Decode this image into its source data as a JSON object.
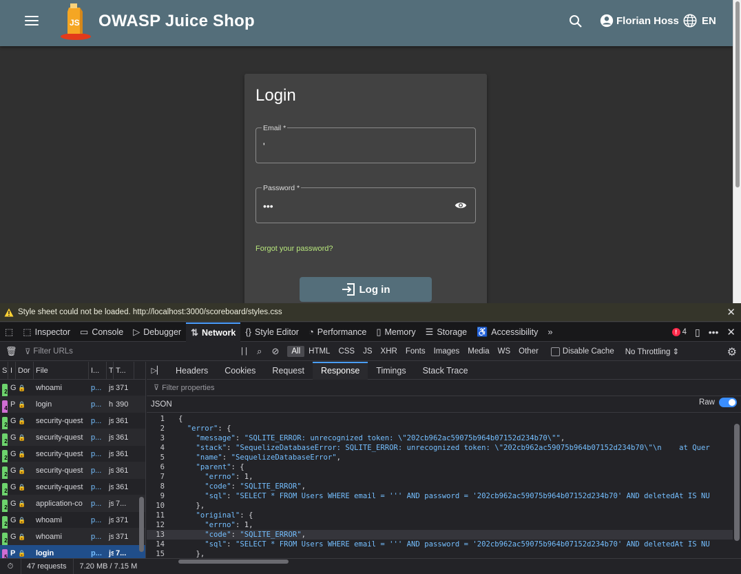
{
  "app": {
    "brand": "OWASP Juice Shop",
    "user": "Florian Hoss",
    "language": "EN"
  },
  "login": {
    "title": "Login",
    "email_label": "Email *",
    "email_value": "'",
    "password_label": "Password *",
    "password_value": "•••",
    "forgot": "Forgot your password?",
    "button": "Log in"
  },
  "devtools": {
    "warning": "Style sheet could not be loaded. http://localhost:3000/scoreboard/styles.css",
    "tabs": [
      {
        "label": "Inspector",
        "icon": "⬚"
      },
      {
        "label": "Console",
        "icon": "▭"
      },
      {
        "label": "Debugger",
        "icon": "▷"
      },
      {
        "label": "Network",
        "icon": "⇅"
      },
      {
        "label": "Style Editor",
        "icon": "{}"
      },
      {
        "label": "Performance",
        "icon": "◔"
      },
      {
        "label": "Memory",
        "icon": "▯"
      },
      {
        "label": "Storage",
        "icon": "☰"
      },
      {
        "label": "Accessibility",
        "icon": "♿"
      }
    ],
    "error_count": "4",
    "filter_urls": "Filter URLs",
    "type_filters": [
      "All",
      "HTML",
      "CSS",
      "JS",
      "XHR",
      "Fonts",
      "Images",
      "Media",
      "WS",
      "Other"
    ],
    "disable_cache": "Disable Cache",
    "throttling": "No Throttling",
    "list_headers": [
      "S",
      "I",
      "Dor",
      "File",
      "I...",
      "T",
      "T..."
    ],
    "requests": [
      {
        "status": "2",
        "method": "G",
        "file": "whoami",
        "initiator": "p...",
        "type": "js",
        "transferred": "371",
        "color": "#6dd36d"
      },
      {
        "status": "4",
        "method": "P",
        "file": "login",
        "initiator": "p...",
        "type": "h",
        "transferred": "390",
        "color": "#d06dd3"
      },
      {
        "status": "2",
        "method": "G",
        "file": "security-quest",
        "initiator": "p...",
        "type": "js",
        "transferred": "361",
        "color": "#6dd36d"
      },
      {
        "status": "2",
        "method": "G",
        "file": "security-quest",
        "initiator": "p...",
        "type": "js",
        "transferred": "361",
        "color": "#6dd36d"
      },
      {
        "status": "2",
        "method": "G",
        "file": "security-quest",
        "initiator": "p...",
        "type": "js",
        "transferred": "361",
        "color": "#6dd36d"
      },
      {
        "status": "2",
        "method": "G",
        "file": "security-quest",
        "initiator": "p...",
        "type": "js",
        "transferred": "361",
        "color": "#6dd36d"
      },
      {
        "status": "2",
        "method": "G",
        "file": "security-quest",
        "initiator": "p...",
        "type": "js",
        "transferred": "361",
        "color": "#6dd36d"
      },
      {
        "status": "2",
        "method": "G",
        "file": "application-co",
        "initiator": "p...",
        "type": "js",
        "transferred": "7...",
        "color": "#6dd36d"
      },
      {
        "status": "2",
        "method": "G",
        "file": "whoami",
        "initiator": "p...",
        "type": "js",
        "transferred": "371",
        "color": "#6dd36d"
      },
      {
        "status": "2",
        "method": "G",
        "file": "whoami",
        "initiator": "p...",
        "type": "js",
        "transferred": "371",
        "color": "#6dd36d"
      },
      {
        "status": "5",
        "method": "P",
        "file": "login",
        "initiator": "p...",
        "type": "js",
        "transferred": "7...",
        "color": "#d06dd3"
      }
    ],
    "summary_requests": "47 requests",
    "summary_size": "7.20 MB / 7.15 M",
    "detail_tabs": [
      "Headers",
      "Cookies",
      "Request",
      "Response",
      "Timings",
      "Stack Trace"
    ],
    "filter_props": "Filter properties",
    "json_label": "JSON",
    "raw_label": "Raw",
    "code_lines": [
      {
        "n": "1",
        "html": "{"
      },
      {
        "n": "2",
        "html": "  <span class=\"k\">\"error\"</span>: {"
      },
      {
        "n": "3",
        "html": "    <span class=\"k\">\"message\"</span>: <span class=\"s\">\"SQLITE_ERROR: unrecognized token: \\\"202cb962ac59075b964b07152d234b70\\\"\"</span>,"
      },
      {
        "n": "4",
        "html": "    <span class=\"k\">\"stack\"</span>: <span class=\"s\">\"SequelizeDatabaseError: SQLITE_ERROR: unrecognized token: \\\"202cb962ac59075b964b07152d234b70\\\"\\n    at Quer</span>"
      },
      {
        "n": "5",
        "html": "    <span class=\"k\">\"name\"</span>: <span class=\"s\">\"SequelizeDatabaseError\"</span>,"
      },
      {
        "n": "6",
        "html": "    <span class=\"k\">\"parent\"</span>: {"
      },
      {
        "n": "7",
        "html": "      <span class=\"k\">\"errno\"</span>: 1,"
      },
      {
        "n": "8",
        "html": "      <span class=\"k\">\"code\"</span>: <span class=\"s\">\"SQLITE_ERROR\"</span>,"
      },
      {
        "n": "9",
        "html": "      <span class=\"k\">\"sql\"</span>: <span class=\"s\">\"SELECT * FROM Users WHERE email = ''' AND password = '202cb962ac59075b964b07152d234b70' AND deletedAt IS NU</span>"
      },
      {
        "n": "10",
        "html": "    },"
      },
      {
        "n": "11",
        "html": "    <span class=\"k\">\"original\"</span>: {"
      },
      {
        "n": "12",
        "html": "      <span class=\"k\">\"errno\"</span>: 1,"
      },
      {
        "n": "13",
        "html": "      <span class=\"k\">\"code\"</span>: <span class=\"s\">\"SQLITE_ERROR\"</span>,"
      },
      {
        "n": "14",
        "html": "      <span class=\"k\">\"sql\"</span>: <span class=\"s\">\"SELECT * FROM Users WHERE email = ''' AND password = '202cb962ac59075b964b07152d234b70' AND deletedAt IS NU</span>"
      },
      {
        "n": "15",
        "html": "    },"
      },
      {
        "n": "16",
        "html": ""
      }
    ],
    "highlight_line": "13"
  }
}
